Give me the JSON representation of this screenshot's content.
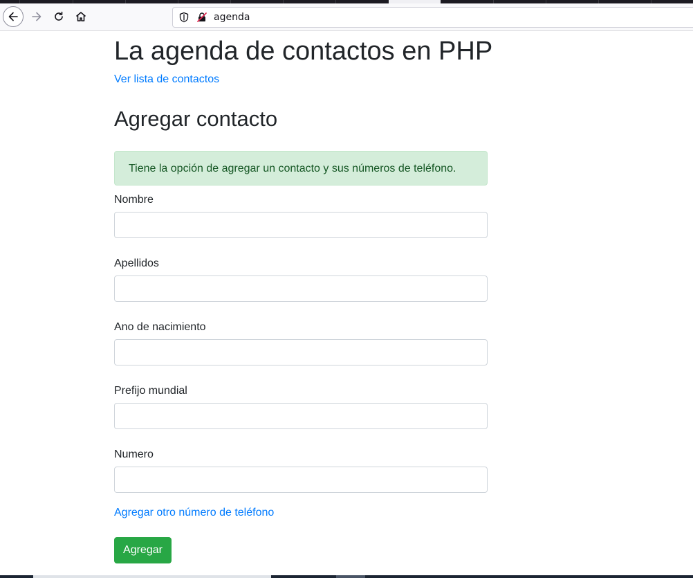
{
  "browser": {
    "url": "agenda",
    "icons": {
      "back": "arrow-left-icon",
      "forward": "arrow-right-icon",
      "reload": "reload-icon",
      "home": "home-icon",
      "shield": "shield-icon",
      "insecure": "insecure-connection-icon"
    }
  },
  "page": {
    "title": "La agenda de contactos en PHP",
    "list_link": "Ver lista de contactos",
    "section_title": "Agregar contacto",
    "alert_text": "Tiene la opción de agregar un contacto y sus números de teléfono.",
    "fields": [
      {
        "label": "Nombre",
        "value": ""
      },
      {
        "label": "Apellidos",
        "value": ""
      },
      {
        "label": "Ano de nacimiento",
        "value": ""
      },
      {
        "label": "Prefijo mundial",
        "value": ""
      },
      {
        "label": "Numero",
        "value": ""
      }
    ],
    "add_phone_link": "Agregar otro número de teléfono",
    "submit_label": "Agregar"
  },
  "colors": {
    "link": "#007bff",
    "alert_background": "#d4edda",
    "alert_text": "#155724",
    "submit_button": "#28a745"
  }
}
